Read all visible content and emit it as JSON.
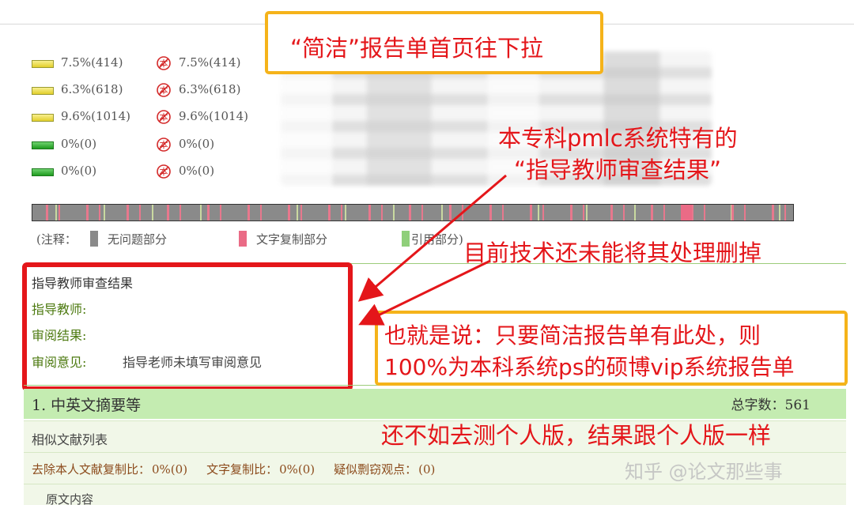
{
  "stats": [
    {
      "color": "yellow",
      "value": "7.5%(414)",
      "value2": "7.5%(414)"
    },
    {
      "color": "yellow",
      "value": "6.3%(618)",
      "value2": "6.3%(618)"
    },
    {
      "color": "yellow",
      "value": "9.6%(1014)",
      "value2": "9.6%(1014)"
    },
    {
      "color": "green",
      "value": "0%(0)",
      "value2": "0%(0)"
    },
    {
      "color": "green",
      "value": "0%(0)",
      "value2": "0%(0)"
    }
  ],
  "legend": {
    "prefix": "(注释：",
    "items": [
      {
        "label": "无问题部分",
        "color": "#8a8a8a"
      },
      {
        "label": "文字复制部分",
        "color": "#ea6b86"
      },
      {
        "label": "引用部分)",
        "color": "#8fcf7a"
      }
    ]
  },
  "advisor": {
    "title": "指导教师审查结果",
    "teacher_label": "指导教师:",
    "result_label": "审阅结果:",
    "opinion_label": "审阅意见:",
    "opinion_value": "指导老师未填写审阅意见"
  },
  "section": {
    "name": "1. 中英文摘要等",
    "word_count": "总字数：561",
    "similar_list": "相似文献列表",
    "ratio1_label": "去除本人文献复制比：",
    "ratio1_value": "0%(0)",
    "ratio2_label": "文字复制比：",
    "ratio2_value": "0%(0)",
    "ratio3_label": "疑似剽窃观点：",
    "ratio3_value": "(0)",
    "original": "原文内容"
  },
  "annotations": {
    "title": "“简洁”报告单首页往下拉",
    "note1_line1": "本专科pmlc系统特有的",
    "note1_line2": "“指导教师审查结果”",
    "note2": "目前技术还未能将其处理删掉",
    "explain_line1": "也就是说：只要简洁报告单有此处，则",
    "explain_line2": "100%为本科系统ps的硕博vip系统报告单",
    "note3": "还不如去测个人版，结果跟个人版一样"
  },
  "watermark": "知乎 @论文那些事",
  "colors": {
    "annotation_red": "#e4161a",
    "callout_border": "#f5b31a",
    "section_green": "#c4ecb1"
  }
}
